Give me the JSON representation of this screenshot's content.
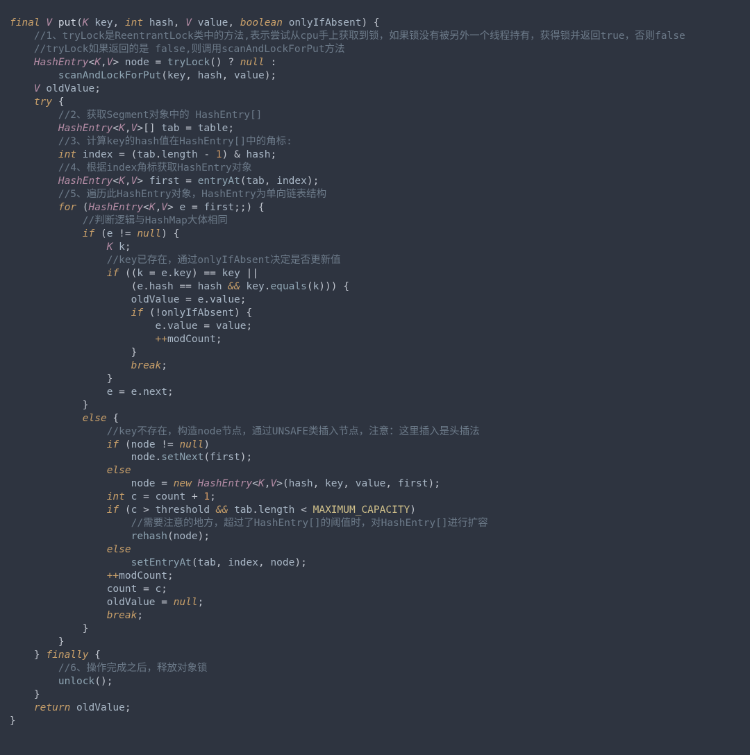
{
  "code": {
    "lines": [
      [
        [
          "kw",
          "final"
        ],
        [
          "op",
          " "
        ],
        [
          "typ",
          "V"
        ],
        [
          "op",
          " "
        ],
        [
          "def",
          "put"
        ],
        [
          "punc",
          "("
        ],
        [
          "typ",
          "K"
        ],
        [
          "op",
          " "
        ],
        [
          "id",
          "key"
        ],
        [
          "punc",
          ", "
        ],
        [
          "kw",
          "int"
        ],
        [
          "op",
          " "
        ],
        [
          "id",
          "hash"
        ],
        [
          "punc",
          ", "
        ],
        [
          "typ",
          "V"
        ],
        [
          "op",
          " "
        ],
        [
          "id",
          "value"
        ],
        [
          "punc",
          ", "
        ],
        [
          "kw",
          "boolean"
        ],
        [
          "op",
          " "
        ],
        [
          "id",
          "onlyIfAbsent"
        ],
        [
          "punc",
          ") {"
        ]
      ],
      [
        [
          "op",
          "    "
        ],
        [
          "cmt",
          "//1、tryLock是ReentrantLock类中的方法,表示尝试从cpu手上获取到锁，如果锁没有被另外一个线程持有，获得锁并返回true，否则false"
        ]
      ],
      [
        [
          "op",
          "    "
        ],
        [
          "cmt",
          "//tryLock如果返回的是 false,则调用scanAndLockForPut方法"
        ]
      ],
      [
        [
          "op",
          "    "
        ],
        [
          "typ",
          "HashEntry"
        ],
        [
          "punc",
          "<"
        ],
        [
          "typ",
          "K"
        ],
        [
          "punc",
          ","
        ],
        [
          "typ",
          "V"
        ],
        [
          "punc",
          "> "
        ],
        [
          "id",
          "node"
        ],
        [
          "op",
          " = "
        ],
        [
          "call",
          "tryLock"
        ],
        [
          "punc",
          "() ? "
        ],
        [
          "lit",
          "null"
        ],
        [
          "op",
          " :"
        ]
      ],
      [
        [
          "op",
          "        "
        ],
        [
          "call",
          "scanAndLockForPut"
        ],
        [
          "punc",
          "("
        ],
        [
          "id",
          "key"
        ],
        [
          "punc",
          ", "
        ],
        [
          "id",
          "hash"
        ],
        [
          "punc",
          ", "
        ],
        [
          "id",
          "value"
        ],
        [
          "punc",
          ");"
        ]
      ],
      [
        [
          "op",
          "    "
        ],
        [
          "typ",
          "V"
        ],
        [
          "op",
          " "
        ],
        [
          "id",
          "oldValue"
        ],
        [
          "punc",
          ";"
        ]
      ],
      [
        [
          "op",
          "    "
        ],
        [
          "kw",
          "try"
        ],
        [
          "punc",
          " {"
        ]
      ],
      [
        [
          "op",
          "        "
        ],
        [
          "cmt",
          "//2、获取Segment对象中的 HashEntry[]"
        ]
      ],
      [
        [
          "op",
          "        "
        ],
        [
          "typ",
          "HashEntry"
        ],
        [
          "punc",
          "<"
        ],
        [
          "typ",
          "K"
        ],
        [
          "punc",
          ","
        ],
        [
          "typ",
          "V"
        ],
        [
          "punc",
          ">[] "
        ],
        [
          "id",
          "tab"
        ],
        [
          "op",
          " = "
        ],
        [
          "id",
          "table"
        ],
        [
          "punc",
          ";"
        ]
      ],
      [
        [
          "op",
          "        "
        ],
        [
          "cmt",
          "//3、计算key的hash值在HashEntry[]中的角标:"
        ]
      ],
      [
        [
          "op",
          "        "
        ],
        [
          "kw",
          "int"
        ],
        [
          "op",
          " "
        ],
        [
          "id",
          "index"
        ],
        [
          "op",
          " = ("
        ],
        [
          "id",
          "tab"
        ],
        [
          "punc",
          "."
        ],
        [
          "id",
          "length"
        ],
        [
          "op",
          " - "
        ],
        [
          "num",
          "1"
        ],
        [
          "op",
          ") & "
        ],
        [
          "id",
          "hash"
        ],
        [
          "punc",
          ";"
        ]
      ],
      [
        [
          "op",
          "        "
        ],
        [
          "cmt",
          "//4、根据index角标获取HashEntry对象"
        ]
      ],
      [
        [
          "op",
          "        "
        ],
        [
          "typ",
          "HashEntry"
        ],
        [
          "punc",
          "<"
        ],
        [
          "typ",
          "K"
        ],
        [
          "punc",
          ","
        ],
        [
          "typ",
          "V"
        ],
        [
          "punc",
          "> "
        ],
        [
          "id",
          "first"
        ],
        [
          "op",
          " = "
        ],
        [
          "call",
          "entryAt"
        ],
        [
          "punc",
          "("
        ],
        [
          "id",
          "tab"
        ],
        [
          "punc",
          ", "
        ],
        [
          "id",
          "index"
        ],
        [
          "punc",
          ");"
        ]
      ],
      [
        [
          "op",
          "        "
        ],
        [
          "cmt",
          "//5、遍历此HashEntry对象，HashEntry为单向链表结构"
        ]
      ],
      [
        [
          "op",
          "        "
        ],
        [
          "kw",
          "for"
        ],
        [
          "punc",
          " ("
        ],
        [
          "typ",
          "HashEntry"
        ],
        [
          "punc",
          "<"
        ],
        [
          "typ",
          "K"
        ],
        [
          "punc",
          ","
        ],
        [
          "typ",
          "V"
        ],
        [
          "punc",
          "> "
        ],
        [
          "id",
          "e"
        ],
        [
          "op",
          " = "
        ],
        [
          "id",
          "first"
        ],
        [
          "punc",
          ";;) {"
        ]
      ],
      [
        [
          "op",
          "            "
        ],
        [
          "cmt",
          "//判断逻辑与HashMap大体相同"
        ]
      ],
      [
        [
          "op",
          "            "
        ],
        [
          "kw",
          "if"
        ],
        [
          "punc",
          " ("
        ],
        [
          "id",
          "e"
        ],
        [
          "op",
          " != "
        ],
        [
          "lit",
          "null"
        ],
        [
          "punc",
          ") {"
        ]
      ],
      [
        [
          "op",
          "                "
        ],
        [
          "typ",
          "K"
        ],
        [
          "op",
          " "
        ],
        [
          "id",
          "k"
        ],
        [
          "punc",
          ";"
        ]
      ],
      [
        [
          "op",
          "                "
        ],
        [
          "cmt",
          "//key已存在，通过onlyIfAbsent决定是否更新值"
        ]
      ],
      [
        [
          "op",
          "                "
        ],
        [
          "kw",
          "if"
        ],
        [
          "punc",
          " (("
        ],
        [
          "id",
          "k"
        ],
        [
          "op",
          " = "
        ],
        [
          "id",
          "e"
        ],
        [
          "punc",
          "."
        ],
        [
          "id",
          "key"
        ],
        [
          "punc",
          ") "
        ],
        [
          "op",
          "=="
        ],
        [
          "op",
          " "
        ],
        [
          "id",
          "key"
        ],
        [
          "op",
          " ||"
        ]
      ],
      [
        [
          "op",
          "                    ("
        ],
        [
          "id",
          "e"
        ],
        [
          "punc",
          "."
        ],
        [
          "id",
          "hash"
        ],
        [
          "op",
          " == "
        ],
        [
          "id",
          "hash"
        ],
        [
          "op",
          " "
        ],
        [
          "kw",
          "&&"
        ],
        [
          "op",
          " "
        ],
        [
          "id",
          "key"
        ],
        [
          "punc",
          "."
        ],
        [
          "call",
          "equals"
        ],
        [
          "punc",
          "("
        ],
        [
          "id",
          "k"
        ],
        [
          "punc",
          "))) {"
        ]
      ],
      [
        [
          "op",
          "                    "
        ],
        [
          "id",
          "oldValue"
        ],
        [
          "op",
          " = "
        ],
        [
          "id",
          "e"
        ],
        [
          "punc",
          "."
        ],
        [
          "id",
          "value"
        ],
        [
          "punc",
          ";"
        ]
      ],
      [
        [
          "op",
          "                    "
        ],
        [
          "kw",
          "if"
        ],
        [
          "punc",
          " (!"
        ],
        [
          "id",
          "onlyIfAbsent"
        ],
        [
          "punc",
          ") {"
        ]
      ],
      [
        [
          "op",
          "                        "
        ],
        [
          "id",
          "e"
        ],
        [
          "punc",
          "."
        ],
        [
          "id",
          "value"
        ],
        [
          "op",
          " = "
        ],
        [
          "id",
          "value"
        ],
        [
          "punc",
          ";"
        ]
      ],
      [
        [
          "op",
          "                        "
        ],
        [
          "kw",
          "++"
        ],
        [
          "id",
          "modCount"
        ],
        [
          "punc",
          ";"
        ]
      ],
      [
        [
          "op",
          "                    "
        ],
        [
          "punc",
          "}"
        ]
      ],
      [
        [
          "op",
          "                    "
        ],
        [
          "kw",
          "break"
        ],
        [
          "punc",
          ";"
        ]
      ],
      [
        [
          "op",
          "                "
        ],
        [
          "punc",
          "}"
        ]
      ],
      [
        [
          "op",
          "                "
        ],
        [
          "id",
          "e"
        ],
        [
          "op",
          " = "
        ],
        [
          "id",
          "e"
        ],
        [
          "punc",
          "."
        ],
        [
          "id",
          "next"
        ],
        [
          "punc",
          ";"
        ]
      ],
      [
        [
          "op",
          "            "
        ],
        [
          "punc",
          "}"
        ]
      ],
      [
        [
          "op",
          "            "
        ],
        [
          "kw",
          "else"
        ],
        [
          "punc",
          " {"
        ]
      ],
      [
        [
          "op",
          "                "
        ],
        [
          "cmt",
          "//key不存在，构造node节点，通过UNSAFE类插入节点，注意：这里插入是头插法"
        ]
      ],
      [
        [
          "op",
          "                "
        ],
        [
          "kw",
          "if"
        ],
        [
          "punc",
          " ("
        ],
        [
          "id",
          "node"
        ],
        [
          "op",
          " != "
        ],
        [
          "lit",
          "null"
        ],
        [
          "punc",
          ")"
        ]
      ],
      [
        [
          "op",
          "                    "
        ],
        [
          "id",
          "node"
        ],
        [
          "punc",
          "."
        ],
        [
          "call",
          "setNext"
        ],
        [
          "punc",
          "("
        ],
        [
          "id",
          "first"
        ],
        [
          "punc",
          ");"
        ]
      ],
      [
        [
          "op",
          "                "
        ],
        [
          "kw",
          "else"
        ]
      ],
      [
        [
          "op",
          "                    "
        ],
        [
          "id",
          "node"
        ],
        [
          "op",
          " = "
        ],
        [
          "kw",
          "new"
        ],
        [
          "op",
          " "
        ],
        [
          "typ",
          "HashEntry"
        ],
        [
          "punc",
          "<"
        ],
        [
          "typ",
          "K"
        ],
        [
          "punc",
          ","
        ],
        [
          "typ",
          "V"
        ],
        [
          "punc",
          ">("
        ],
        [
          "id",
          "hash"
        ],
        [
          "punc",
          ", "
        ],
        [
          "id",
          "key"
        ],
        [
          "punc",
          ", "
        ],
        [
          "id",
          "value"
        ],
        [
          "punc",
          ", "
        ],
        [
          "id",
          "first"
        ],
        [
          "punc",
          ");"
        ]
      ],
      [
        [
          "op",
          "                "
        ],
        [
          "kw",
          "int"
        ],
        [
          "op",
          " "
        ],
        [
          "id",
          "c"
        ],
        [
          "op",
          " = "
        ],
        [
          "id",
          "count"
        ],
        [
          "op",
          " + "
        ],
        [
          "num",
          "1"
        ],
        [
          "punc",
          ";"
        ]
      ],
      [
        [
          "op",
          "                "
        ],
        [
          "kw",
          "if"
        ],
        [
          "punc",
          " ("
        ],
        [
          "id",
          "c"
        ],
        [
          "op",
          " > "
        ],
        [
          "id",
          "threshold"
        ],
        [
          "op",
          " "
        ],
        [
          "kw",
          "&&"
        ],
        [
          "op",
          " "
        ],
        [
          "id",
          "tab"
        ],
        [
          "punc",
          "."
        ],
        [
          "id",
          "length"
        ],
        [
          "op",
          " < "
        ],
        [
          "const",
          "MAXIMUM_CAPACITY"
        ],
        [
          "punc",
          ")"
        ]
      ],
      [
        [
          "op",
          "                    "
        ],
        [
          "cmt",
          "//需要注意的地方，超过了HashEntry[]的阈值时，对HashEntry[]进行扩容"
        ]
      ],
      [
        [
          "op",
          "                    "
        ],
        [
          "call",
          "rehash"
        ],
        [
          "punc",
          "("
        ],
        [
          "id",
          "node"
        ],
        [
          "punc",
          ");"
        ]
      ],
      [
        [
          "op",
          "                "
        ],
        [
          "kw",
          "else"
        ]
      ],
      [
        [
          "op",
          "                    "
        ],
        [
          "call",
          "setEntryAt"
        ],
        [
          "punc",
          "("
        ],
        [
          "id",
          "tab"
        ],
        [
          "punc",
          ", "
        ],
        [
          "id",
          "index"
        ],
        [
          "punc",
          ", "
        ],
        [
          "id",
          "node"
        ],
        [
          "punc",
          ");"
        ]
      ],
      [
        [
          "op",
          "                "
        ],
        [
          "kw",
          "++"
        ],
        [
          "id",
          "modCount"
        ],
        [
          "punc",
          ";"
        ]
      ],
      [
        [
          "op",
          "                "
        ],
        [
          "id",
          "count"
        ],
        [
          "op",
          " = "
        ],
        [
          "id",
          "c"
        ],
        [
          "punc",
          ";"
        ]
      ],
      [
        [
          "op",
          "                "
        ],
        [
          "id",
          "oldValue"
        ],
        [
          "op",
          " = "
        ],
        [
          "lit",
          "null"
        ],
        [
          "punc",
          ";"
        ]
      ],
      [
        [
          "op",
          "                "
        ],
        [
          "kw",
          "break"
        ],
        [
          "punc",
          ";"
        ]
      ],
      [
        [
          "op",
          "            "
        ],
        [
          "punc",
          "}"
        ]
      ],
      [
        [
          "op",
          "        "
        ],
        [
          "punc",
          "}"
        ]
      ],
      [
        [
          "op",
          "    "
        ],
        [
          "punc",
          "} "
        ],
        [
          "kw",
          "finally"
        ],
        [
          "punc",
          " {"
        ]
      ],
      [
        [
          "op",
          "        "
        ],
        [
          "cmt",
          "//6、操作完成之后，释放对象锁"
        ]
      ],
      [
        [
          "op",
          "        "
        ],
        [
          "call",
          "unlock"
        ],
        [
          "punc",
          "();"
        ]
      ],
      [
        [
          "op",
          "    "
        ],
        [
          "punc",
          "}"
        ]
      ],
      [
        [
          "op",
          "    "
        ],
        [
          "kw",
          "return"
        ],
        [
          "op",
          " "
        ],
        [
          "id",
          "oldValue"
        ],
        [
          "punc",
          ";"
        ]
      ],
      [
        [
          "punc",
          "}"
        ]
      ]
    ]
  }
}
